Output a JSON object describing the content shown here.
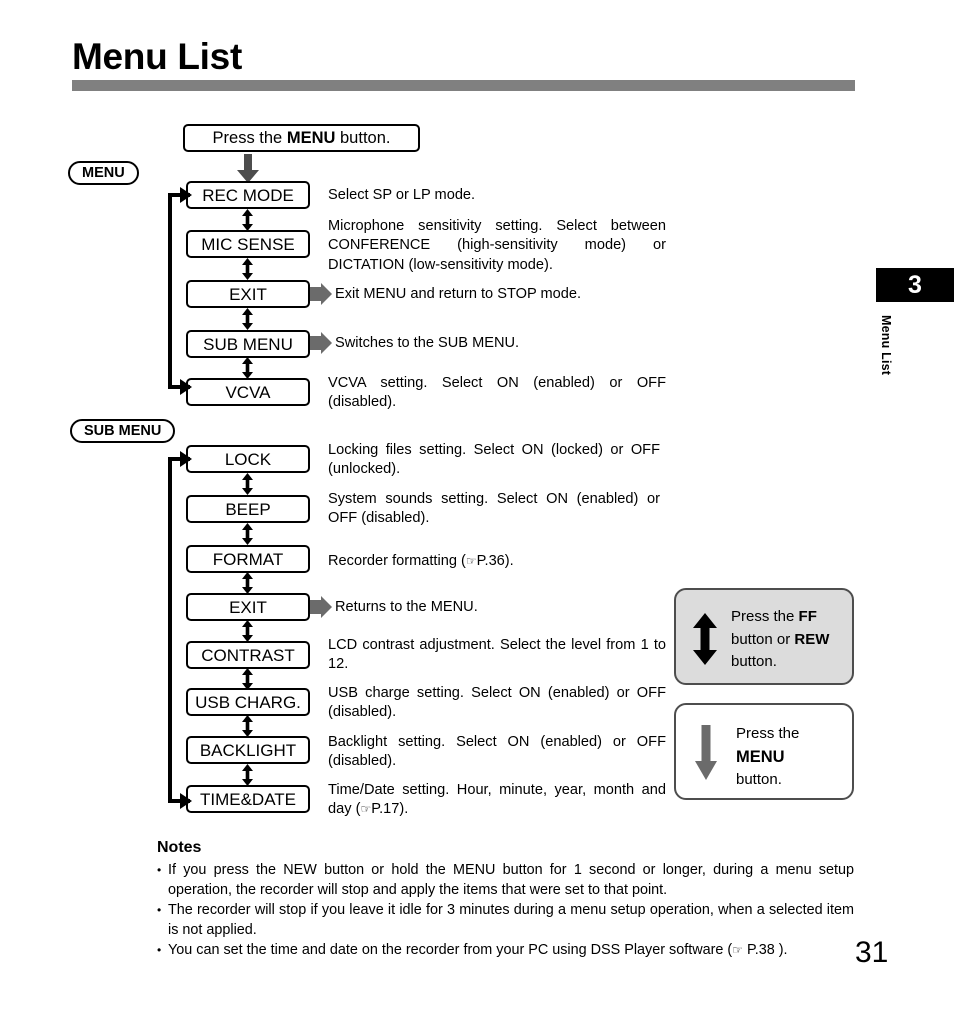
{
  "header": {
    "title": "Menu List",
    "rule_color": "#808080"
  },
  "chapter_tab": {
    "number": "3",
    "label": "Menu List",
    "background": "#000000",
    "text_color": "#ffffff"
  },
  "diagram": {
    "entry_box": {
      "prefix": "Press the ",
      "bold": "MENU",
      "suffix": " button."
    },
    "menu_badge": "MENU",
    "submenu_badge": "SUB MENU",
    "menu_items": [
      {
        "label": "REC MODE",
        "desc": "Select SP or LP mode.",
        "pointer": false
      },
      {
        "label": "MIC SENSE",
        "desc": "Microphone sensitivity setting. Select between CONFERENCE (high-sensitivity mode) or DICTATION (low-sensitivity mode).",
        "pointer": false
      },
      {
        "label": "EXIT",
        "desc": "Exit MENU and return to STOP mode.",
        "pointer": true
      },
      {
        "label": "SUB MENU",
        "desc": "Switches to the SUB MENU.",
        "pointer": true
      },
      {
        "label": "VCVA",
        "desc": "VCVA setting. Select ON (enabled) or OFF (disabled).",
        "pointer": false
      }
    ],
    "submenu_items": [
      {
        "label": "LOCK",
        "desc": "Locking files setting. Select ON (locked) or OFF (unlocked).",
        "pointer": false
      },
      {
        "label": "BEEP",
        "desc": "System sounds setting. Select ON (enabled) or OFF (disabled).",
        "pointer": false
      },
      {
        "label": "FORMAT",
        "desc_pre": "Recorder formatting (",
        "desc_ref": "P.36",
        "desc_post": ").",
        "pointer": false
      },
      {
        "label": "EXIT",
        "desc": "Returns to the MENU.",
        "pointer": true
      },
      {
        "label": "CONTRAST",
        "desc": "LCD contrast adjustment. Select the level from 1 to 12.",
        "pointer": false
      },
      {
        "label": "USB CHARG.",
        "desc": "USB charge setting. Select ON (enabled) or OFF (disabled).",
        "pointer": false
      },
      {
        "label": "BACKLIGHT",
        "desc": "Backlight setting. Select ON (enabled) or OFF (disabled).",
        "pointer": false
      },
      {
        "label": "TIME&DATE",
        "desc_pre": "Time/Date setting. Hour, minute, year, month and day (",
        "desc_ref": "P.17",
        "desc_post": ").",
        "pointer": false
      }
    ]
  },
  "legend": {
    "ff_rew": {
      "line1_pre": "Press the ",
      "line1_bold": "FF",
      "line2_pre": "button or ",
      "line2_bold": "REW",
      "line3": "button.",
      "icon": "up-down-arrow-icon",
      "background": "#dcdcdc"
    },
    "menu": {
      "line1": "Press the ",
      "line2_bold": "MENU",
      "line3": "button.",
      "icon": "down-arrow-icon",
      "background": "#ffffff"
    }
  },
  "notes": {
    "heading": "Notes",
    "items": [
      "If you press the NEW button or hold the MENU button for 1 second or longer, during a menu setup operation, the recorder will stop and apply the items that were set to that point.",
      "The recorder will stop if you leave it idle for 3 minutes during a menu setup operation, when a selected item is not applied."
    ],
    "last_item": {
      "pre": "You can set the time and date on the recorder from your PC using DSS Player software (",
      "ref": " P.38 ",
      "post": ")."
    }
  },
  "page_number": "31"
}
